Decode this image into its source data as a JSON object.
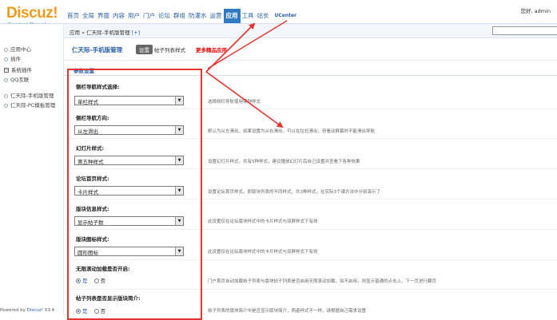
{
  "header": {
    "logo": "Discuz!",
    "logo_sub": "Control Panel",
    "nav": [
      "首页",
      "全局",
      "界面",
      "内容",
      "用户",
      "门户",
      "论坛",
      "群组",
      "防灌水",
      "运营",
      "应用",
      "工具",
      "站长",
      "UCenter"
    ],
    "active_nav": "应用",
    "greeting": "您好, admin"
  },
  "sidebar": {
    "items": [
      "应用中心",
      "插件",
      "系统插件",
      "QQ互联",
      "仁天际-手机版管理",
      "仁天际-PC模板管理"
    ],
    "powered": "Powered by",
    "powered_brand": "Discuz!",
    "version": "X3.4"
  },
  "breadcrumb": {
    "path": "应用 » 仁天际-手机版管理",
    "plus": "[+]"
  },
  "title": {
    "plugin_name": "仁天际-手机版管理",
    "settings_button": "设置",
    "tab_postlist": "帖子列表样式",
    "tab_more": "更多精品应用"
  },
  "section": {
    "title": "参数设置"
  },
  "form": [
    {
      "label": "侧栏导航样式选择:",
      "value": "单栏样式",
      "hint": "选择侧栏导航使用哪种样式"
    },
    {
      "label": "侧栏导航方向:",
      "value": "从左滑出",
      "hint": "默认为从左滑出，如果设置为从右滑出，可以在拉拉滑出，但看动屏幕时不能滑出导航"
    },
    {
      "label": "幻灯片样式:",
      "value": "第五种样式",
      "hint": "设置幻灯片样式，共有5种样式，建议播放幻灯片后自己设置并查看下各种效果"
    },
    {
      "label": "论坛首页样式:",
      "value": "卡片样式",
      "hint": "设置论坛首页样式，即版块列表的不同样式，共3种样式，在实际3个课方法中分别演示了"
    },
    {
      "label": "版块信息样式:",
      "value": "显示帖子数",
      "hint": "此设置仅在论坛版块样式中的卡片样式与双屏样式下有效"
    },
    {
      "label": "版块图标样式:",
      "value": "圆形图标",
      "hint": "此设置仅在论坛版块样式中的卡片样式与双屏样式下有效"
    }
  ],
  "radios": [
    {
      "label": "无限滚动加载是否开启:",
      "yes": "是",
      "no": "否",
      "hint": "门户首页自动加载帖子列表与版块帖子列表是否启用无限滚动加载，如不启用，则显示普通的点击上、下一页进行翻页"
    },
    {
      "label": "帖子列表是否显示版块简介:",
      "yes": "是",
      "no": "否",
      "hint": "帖子列表的版块简介中是否显示版块简介，两者样式不一样，请根据自己需求设置"
    }
  ],
  "colors": {
    "brand_orange": "#f29a1d",
    "nav_active": "#2f79c3",
    "link_blue": "#2a5fa8",
    "annotation_red": "#e3342f"
  }
}
